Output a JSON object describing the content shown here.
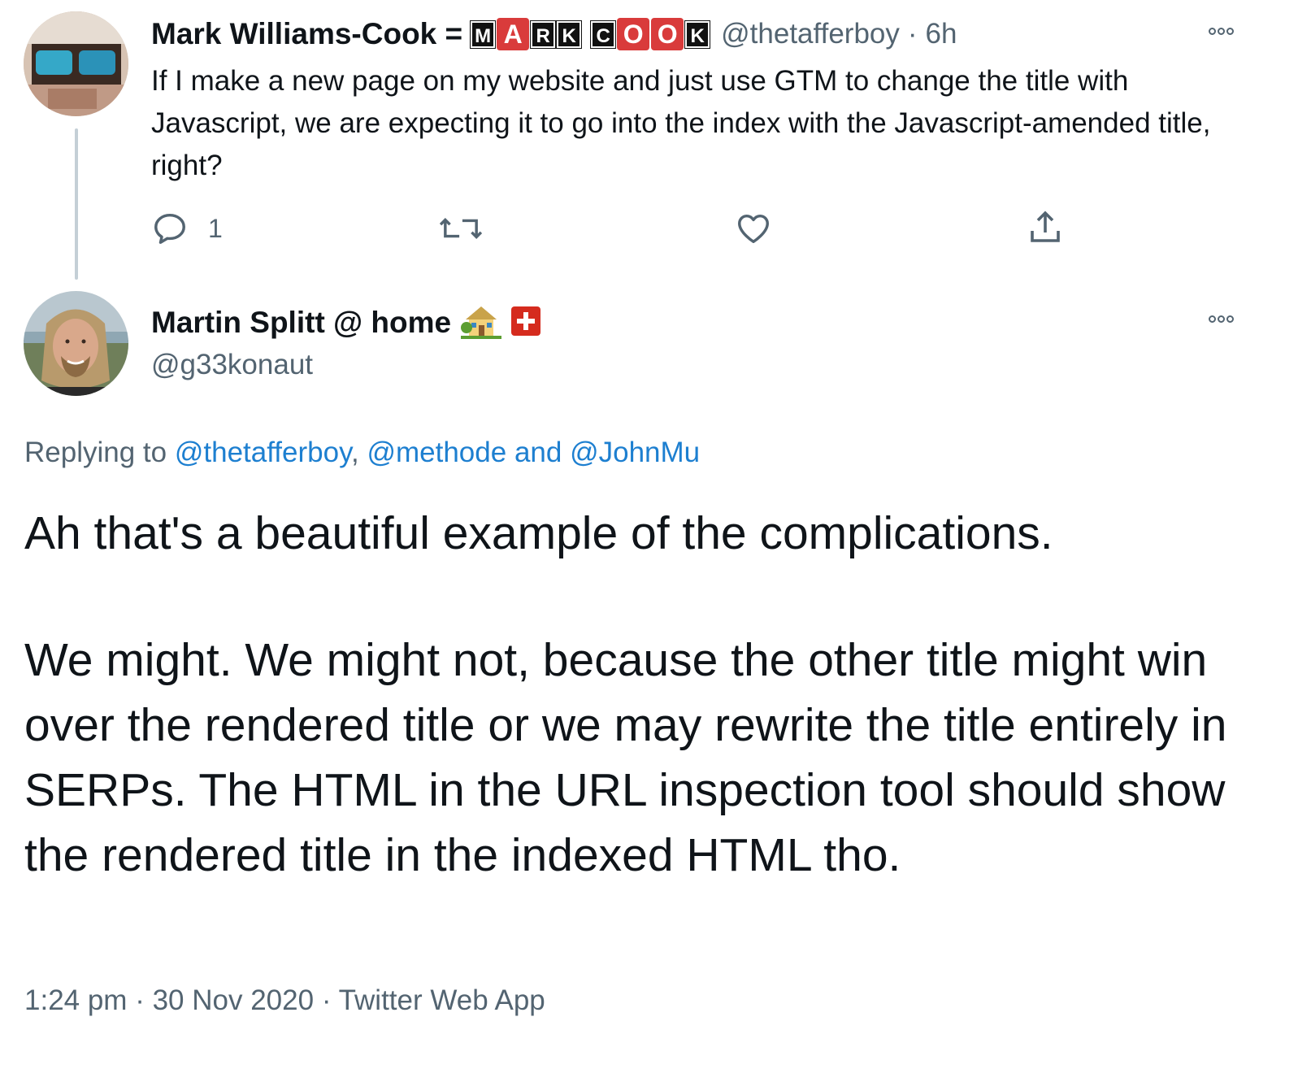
{
  "parent_tweet": {
    "author_name": "Mark Williams-Cook =",
    "logo_letters": [
      "M",
      "A",
      "R",
      "K",
      "C",
      "O",
      "O",
      "K"
    ],
    "handle": "@thetafferboy",
    "separator": "·",
    "time": "6h",
    "text": "If I make a new page on my website and just use GTM to change the title with Javascript, we are expecting it to go into the index with the Javascript-amended title, right?",
    "reply_count": "1",
    "icons": [
      "reply-icon",
      "retweet-icon",
      "like-icon",
      "share-icon",
      "more-icon"
    ]
  },
  "main_tweet": {
    "author_name": "Martin Splitt @ home",
    "emoji": [
      "house-with-garden-icon",
      "swiss-flag-icon"
    ],
    "handle": "@g33konaut",
    "replying_prefix": "Replying to",
    "reply_mentions": [
      "@thetafferboy",
      ",",
      "@methode",
      "and",
      "@JohnMu"
    ],
    "text_paragraph_1": "Ah that's a beautiful example of the complications.",
    "text_paragraph_2": "We might. We might not, because the other title might win over the rendered title or we may rewrite the title entirely in SERPs. The HTML in the URL inspection tool should show the rendered title in the indexed HTML tho.",
    "timestamp_time": "1:24 pm",
    "timestamp_sep_1": "·",
    "timestamp_date": "30 Nov 2020",
    "timestamp_sep_2": "·",
    "source": "Twitter Web App"
  },
  "colors": {
    "text": "#0f1419",
    "muted": "#536471",
    "link": "#1d7fd0",
    "thread_line": "#c4cfd6",
    "logo_red": "#d93b3b"
  }
}
